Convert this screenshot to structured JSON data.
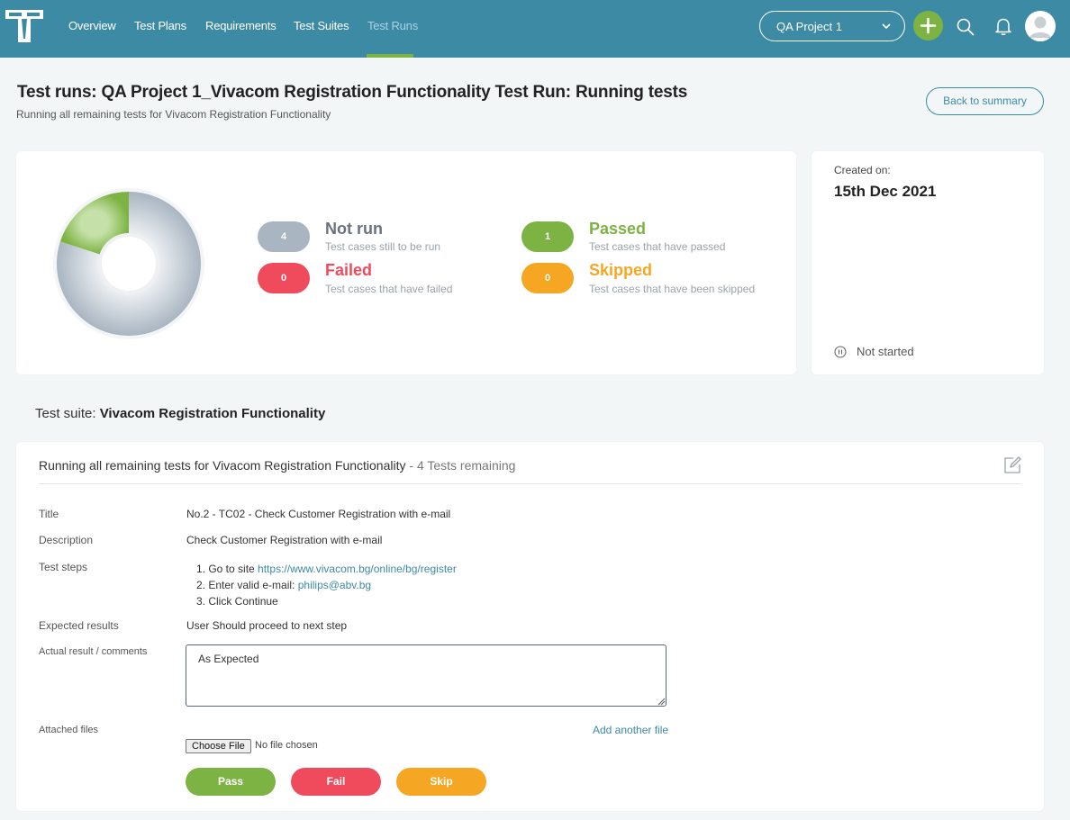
{
  "colors": {
    "topbar": "#3d8aa5",
    "accent_green": "#7cb342",
    "passed": "#7cb342",
    "failed": "#f04b5c",
    "skipped": "#f5a623",
    "not_run": "#a9b5c1",
    "link": "#3d8aa5"
  },
  "nav": {
    "items": [
      {
        "label": "Overview"
      },
      {
        "label": "Test Plans"
      },
      {
        "label": "Requirements"
      },
      {
        "label": "Test Suites"
      },
      {
        "label": "Test Runs"
      }
    ],
    "active": "Test Runs",
    "project_select": "QA Project 1",
    "icons": [
      "logo-icon",
      "chevron-down-icon",
      "plus-icon",
      "search-icon",
      "bell-icon",
      "user-avatar-icon"
    ]
  },
  "header": {
    "title": "Test runs: QA Project 1_Vivacom Registration Functionality Test Run: Running tests",
    "subtitle": "Running all remaining tests for Vivacom Registration Functionality",
    "back_button": "Back to summary"
  },
  "summary": {
    "stats": {
      "not_run": {
        "count": "4",
        "label": "Not run",
        "desc": "Test cases still to be run"
      },
      "passed": {
        "count": "1",
        "label": "Passed",
        "desc": "Test cases that have passed"
      },
      "failed": {
        "count": "0",
        "label": "Failed",
        "desc": "Test cases that have failed"
      },
      "skipped": {
        "count": "0",
        "label": "Skipped",
        "desc": "Test cases that have been skipped"
      }
    },
    "donut_values": {
      "passed": 1,
      "not_run": 4,
      "failed": 0,
      "skipped": 0
    }
  },
  "info": {
    "created_label": "Created on:",
    "created_date": "15th Dec 2021",
    "status": "Not started"
  },
  "suite": {
    "prefix": "Test suite:",
    "name": "Vivacom Registration Functionality"
  },
  "run": {
    "heading": "Running all remaining tests for Vivacom Registration Functionality",
    "remaining": "- 4 Tests remaining",
    "fields": {
      "title_label": "Title",
      "title_value": "No.2 - TC02 - Check Customer Registration with e-mail",
      "description_label": "Description",
      "description_value": "Check Customer Registration with e-mail",
      "steps_label": "Test steps",
      "step1_text": "Go to site",
      "step1_link": "https://www.vivacom.bg/online/bg/register",
      "step2_text": "Enter valid e-mail:",
      "step2_link": "philips@abv.bg",
      "step3_text": "Click Continue",
      "expected_label": "Expected results",
      "expected_value": "User Should proceed to next step",
      "actual_label": "Actual result / comments",
      "actual_value": "As Expected",
      "files_label": "Attached files",
      "add_file": "Add another file",
      "choose_file": "Choose File",
      "no_file": "No file chosen"
    },
    "buttons": {
      "pass": "Pass",
      "fail": "Fail",
      "skip": "Skip"
    }
  }
}
